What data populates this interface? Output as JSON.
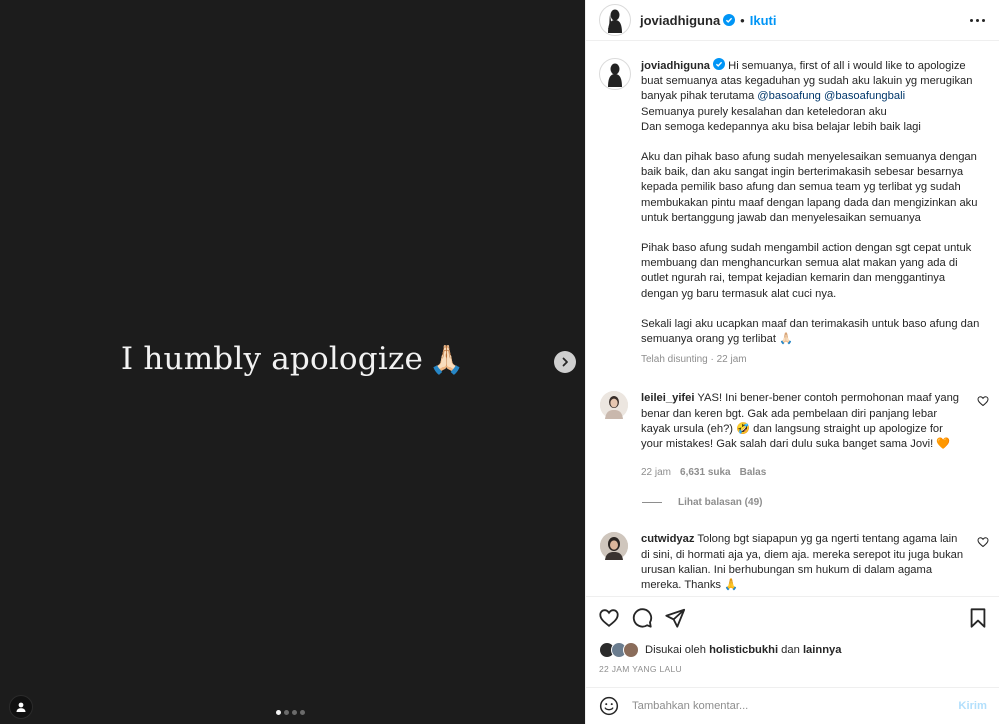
{
  "media": {
    "text": "I humbly apologize",
    "emoji": "🙏🏻",
    "next_icon": "chevron-right-icon",
    "dots": [
      true,
      false,
      false,
      false
    ]
  },
  "header": {
    "username": "joviadhiguna",
    "separator": "•",
    "follow_label": "Ikuti",
    "more_icon": "more-horizontal-icon"
  },
  "caption": {
    "username": "joviadhiguna",
    "lines": {
      "p1_a": "Hi semuanya, first of all i would like to apologize buat semuanya atas kegaduhan yg sudah aku lakuin yg merugikan banyak pihak terutama ",
      "mention1": "@basoafung",
      "mention2": "@basoafungbali",
      "p1_b": "Semuanya purely kesalahan dan keteledoran aku",
      "p1_c": "Dan semoga kedepannya aku bisa belajar lebih baik lagi",
      "p2": "Aku dan pihak baso afung sudah menyelesaikan semuanya dengan baik baik, dan aku sangat ingin berterimakasih sebesar besarnya kepada pemilik baso afung dan semua team yg terlibat yg sudah membukakan pintu maaf dengan lapang dada dan mengizinkan aku untuk bertanggung jawab dan menyelesaikan semuanya",
      "p3": "Pihak baso afung sudah mengambil action dengan sgt cepat untuk membuang dan menghancurkan semua alat makan yang ada di outlet ngurah rai, tempat kejadian kemarin dan menggantinya dengan yg baru termasuk alat cuci nya.",
      "p4": "Sekali lagi aku ucapkan maaf dan terimakasih untuk baso afung dan semuanya orang yg terlibat 🙏🏻"
    },
    "meta": "Telah disunting · 22 jam"
  },
  "comments": [
    {
      "username": "leilei_yifei",
      "text": "YAS! Ini bener-bener contoh permohonan maaf yang benar dan keren bgt. Gak ada pembelaan diri panjang lebar kayak ursula (eh?) 🤣 dan langsung straight up apologize for your mistakes! Gak salah dari dulu suka banget sama Jovi! 🧡",
      "time": "22 jam",
      "likes": "6,631 suka",
      "reply": "Balas",
      "view_replies": "Lihat balasan (49)"
    },
    {
      "username": "cutwidyaz",
      "text": "Tolong bgt siapapun yg ga ngerti tentang agama lain di sini, di hormati aja ya, diem aja. mereka serepot itu juga bukan urusan kalian. Ini berhubungan sm hukum di dalam agama mereka. Thanks 🙏"
    }
  ],
  "likes": {
    "prefix": "Disukai oleh",
    "user": "holisticbukhi",
    "conj": "dan",
    "others": "lainnya"
  },
  "time_ago": "22 JAM YANG LALU",
  "composer": {
    "placeholder": "Tambahkan komentar...",
    "post_label": "Kirim"
  },
  "colors": {
    "accent": "#0095f6",
    "mention": "#00376b",
    "muted": "#8e8e8e",
    "media_bg": "#1c1c1c",
    "heart": "#f77a25"
  }
}
